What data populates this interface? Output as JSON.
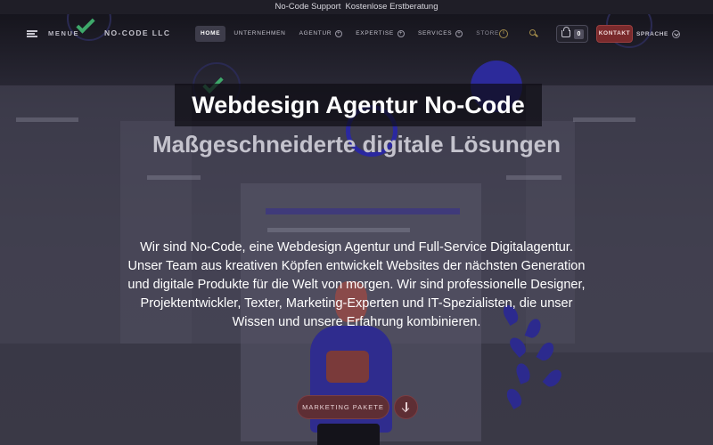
{
  "topbar": {
    "support": "No-Code Support",
    "consult": "Kostenlose Erstberatung"
  },
  "nav": {
    "menu_label": "MENUE",
    "brand": "NO-CODE LLC",
    "items": [
      {
        "label": "HOME",
        "active": true,
        "has_plus": false
      },
      {
        "label": "UNTERNEHMEN",
        "active": false,
        "has_plus": false
      },
      {
        "label": "AGENTUR",
        "active": false,
        "has_plus": true
      },
      {
        "label": "EXPERTISE",
        "active": false,
        "has_plus": true
      },
      {
        "label": "SERVICES",
        "active": false,
        "has_plus": true
      },
      {
        "label": "STORE",
        "active": false,
        "has_plus": false
      }
    ],
    "cart_count": "0",
    "contact_label": "KONTAKT",
    "language_label": "SPRACHE"
  },
  "hero": {
    "title": "Webdesign Agentur No-Code",
    "subtitle": "Maßgeschneiderte digitale Lösungen",
    "body": "Wir sind No-Code, eine Webdesign Agentur und Full-Service Digitalagentur. Unser Team aus kreativen Köpfen entwickelt Websites der nächsten Generation und digitale Produkte für die Welt von morgen. Wir sind professionelle Designer, Projektentwickler, Texter, Marketing-Experten und IT-Spezialisten, die unser Wissen und unsere Erfahrung kombinieren.",
    "cta_label": "MARKETING PAKETE"
  },
  "colors": {
    "accent": "#7a2a2c",
    "background": "#2c2b38",
    "info": "#a08a4a",
    "illustration": "#2c2a9a"
  },
  "icons": [
    "hamburger-icon",
    "info-icon",
    "search-icon",
    "basket-icon",
    "chevron-down-icon",
    "arrow-down-icon"
  ]
}
